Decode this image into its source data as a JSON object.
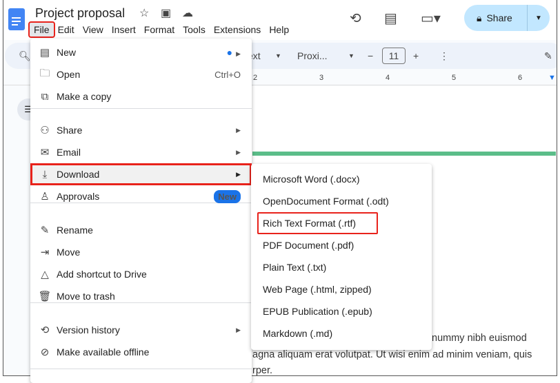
{
  "doc": {
    "title": "Project proposal"
  },
  "menubar": [
    "File",
    "Edit",
    "View",
    "Insert",
    "Format",
    "Tools",
    "Extensions",
    "Help"
  ],
  "share": {
    "label": "Share"
  },
  "toolbar": {
    "style": "ext",
    "font": "Proxi...",
    "font_size": "11"
  },
  "ruler": [
    "2",
    "3",
    "4",
    "5",
    "6"
  ],
  "body_text": [
    "nummy nibh euismod",
    "agna aliquam erat volutpat. Ut wisi enim ad minim veniam, quis",
    "rper."
  ],
  "file_menu": [
    {
      "label": "New",
      "icon": "doc-icon",
      "submenu": true,
      "dot": true
    },
    {
      "label": "Open",
      "icon": "folder-icon",
      "shortcut": "Ctrl+O"
    },
    {
      "label": "Make a copy",
      "icon": "copy-icon"
    },
    {
      "label": "Share",
      "icon": "person-add-icon",
      "submenu": true
    },
    {
      "label": "Email",
      "icon": "mail-icon",
      "submenu": true
    },
    {
      "label": "Download",
      "icon": "download-icon",
      "submenu": true
    },
    {
      "label": "Approvals",
      "icon": "approval-icon",
      "badge": "New"
    },
    {
      "label": "Rename",
      "icon": "rename-icon"
    },
    {
      "label": "Move",
      "icon": "move-icon"
    },
    {
      "label": "Add shortcut to Drive",
      "icon": "drive-shortcut-icon"
    },
    {
      "label": "Move to trash",
      "icon": "trash-icon"
    },
    {
      "label": "Version history",
      "icon": "history-icon",
      "submenu": true
    },
    {
      "label": "Make available offline",
      "icon": "offline-icon"
    }
  ],
  "download_menu": [
    "Microsoft Word (.docx)",
    "OpenDocument Format (.odt)",
    "Rich Text Format (.rtf)",
    "PDF Document (.pdf)",
    "Plain Text (.txt)",
    "Web Page (.html, zipped)",
    "EPUB Publication (.epub)",
    "Markdown (.md)"
  ],
  "colors": {
    "highlight": "#e8221b",
    "share_bg": "#c2e7ff",
    "accent": "#1a73e8"
  }
}
